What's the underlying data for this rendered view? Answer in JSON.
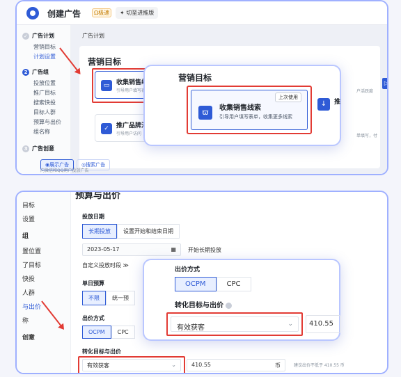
{
  "top": {
    "app_title": "创建广告",
    "badge": "Ω极速",
    "switch_label": "✦ 切至进推版",
    "sidebar": {
      "sections": [
        {
          "num": "✓",
          "label": "广告计划",
          "items": [
            "营销目标",
            "计划设置"
          ]
        },
        {
          "num": "2",
          "label": "广告组",
          "items": [
            "投放位置",
            "推广目标",
            "搜索快投",
            "目标人群",
            "预算与出价",
            "组名称"
          ]
        },
        {
          "num": "3",
          "label": "广告创意",
          "items": []
        }
      ]
    },
    "breadcrumb": "广告计划",
    "section_title": "营销目标",
    "options": [
      {
        "title": "收集销售线",
        "desc": "引导用户填写表"
      },
      {
        "title": "推广品牌活",
        "desc": "引导用户访问"
      }
    ],
    "option3_desc": "户活跃度",
    "option4_desc": "单填写，付",
    "pills": [
      "◉展示广告",
      "◎搜索广告"
    ],
    "hint": "向微信和QQ用户投放广告",
    "popup": {
      "title": "营销目标",
      "selected_title": "收集销售线索",
      "selected_desc": "引导用户填写表单，收集更多线索",
      "selected_tag": "上次使用",
      "next_title": "推",
      "next_desc": "提\n方"
    }
  },
  "bottom": {
    "sidebar": [
      "目标",
      "设置",
      "组",
      "置位置",
      "了目标",
      "快投",
      "人群",
      "与出价",
      "称",
      "创意"
    ],
    "section_title": "预算与出价",
    "date_label": "投放日期",
    "date_tabs": [
      "长期投放",
      "设置开始和结束日期"
    ],
    "start_date": "2023-05-17",
    "long_term": "开始长期投放",
    "custom_time": "自定义投放时段 ≫",
    "budget_label": "单日预算",
    "budget_tabs": [
      "不限",
      "统一预"
    ],
    "bid_method_label": "出价方式",
    "bid_tabs": [
      "OCPM",
      "CPC"
    ],
    "target_label": "转化目标与出价",
    "target_value": "有效获客",
    "bid_value": "410.55",
    "currency": "币",
    "suggest": "建议出价不低于 410.55 币",
    "popup": {
      "title": "出价方式",
      "tabs": [
        "OCPM",
        "CPC"
      ],
      "target_label": "转化目标与出价",
      "target_value": "有效获客",
      "bid_value": "410.55"
    }
  }
}
